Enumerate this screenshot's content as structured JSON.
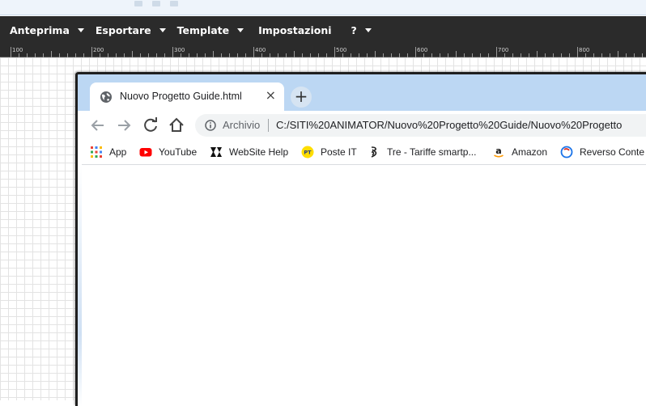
{
  "app": {
    "menu": [
      {
        "label": "Anteprima",
        "has_dropdown": true
      },
      {
        "label": "Esportare",
        "has_dropdown": true
      },
      {
        "label": "Template",
        "has_dropdown": true
      },
      {
        "label": "Impostazioni",
        "has_dropdown": false
      },
      {
        "label": "?",
        "has_dropdown": true
      }
    ],
    "ruler_labels": [
      "100",
      "200",
      "300",
      "400",
      "500",
      "600",
      "700",
      "800"
    ]
  },
  "browser": {
    "tab": {
      "title": "Nuovo Progetto Guide.html",
      "icon": "globe-icon"
    },
    "new_tab_label": "+",
    "close_label": "×",
    "address": {
      "security_label": "Archivio",
      "url": "C:/SITI%20ANIMATOR/Nuovo%20Progetto%20Guide/Nuovo%20Progetto"
    },
    "bookmarks": [
      {
        "label": "App",
        "icon": "apps-grid-icon"
      },
      {
        "label": "YouTube",
        "icon": "youtube-icon"
      },
      {
        "label": "WebSite Help",
        "icon": "website-x5-icon"
      },
      {
        "label": "Poste IT",
        "icon": "poste-icon"
      },
      {
        "label": "Tre - Tariffe smartp...",
        "icon": "tre-icon"
      },
      {
        "label": "Amazon",
        "icon": "amazon-icon"
      },
      {
        "label": "Reverso Conte",
        "icon": "reverso-icon"
      }
    ]
  },
  "colors": {
    "menubar": "#2b2b2b",
    "tabstrip": "#bcd7f3",
    "youtube": "#ff0000",
    "poste": "#ffdd00"
  }
}
